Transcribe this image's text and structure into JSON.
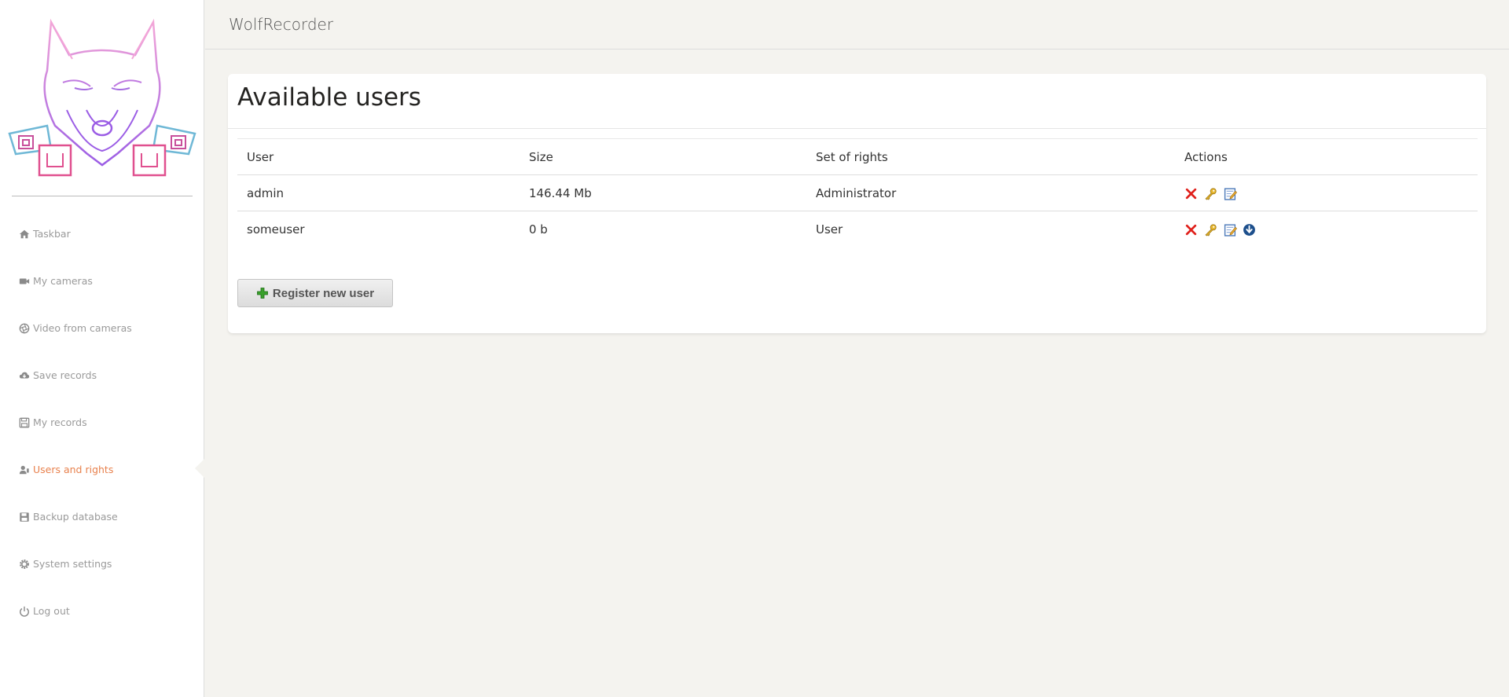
{
  "app": {
    "title": "WolfRecorder"
  },
  "sidebar": {
    "logo_icon": "wolf-camera-logo",
    "items": [
      {
        "label": "Taskbar",
        "icon": "home-icon",
        "active": false
      },
      {
        "label": "My cameras",
        "icon": "video-camera-icon",
        "active": false
      },
      {
        "label": "Video from cameras",
        "icon": "aperture-icon",
        "active": false
      },
      {
        "label": "Save records",
        "icon": "cloud-download-icon",
        "active": false
      },
      {
        "label": "My records",
        "icon": "floppy-disk-icon",
        "active": false
      },
      {
        "label": "Users and rights",
        "icon": "user-key-icon",
        "active": true
      },
      {
        "label": "Backup database",
        "icon": "database-disk-icon",
        "active": false
      },
      {
        "label": "System settings",
        "icon": "gear-icon",
        "active": false
      },
      {
        "label": "Log out",
        "icon": "power-icon",
        "active": false
      }
    ]
  },
  "main": {
    "title": "Available users",
    "table": {
      "headers": [
        "User",
        "Size",
        "Set of rights",
        "Actions"
      ],
      "rows": [
        {
          "user": "admin",
          "size": "146.44 Mb",
          "rights": "Administrator",
          "actions": [
            "delete-icon",
            "key-icon",
            "edit-icon"
          ]
        },
        {
          "user": "someuser",
          "size": "0 b",
          "rights": "User",
          "actions": [
            "delete-icon",
            "key-icon",
            "edit-icon",
            "download-icon"
          ]
        }
      ]
    },
    "register_button": {
      "label": "Register new user",
      "icon": "plus-icon"
    }
  },
  "colors": {
    "accent": "#e8814d",
    "background": "#f4f3ef",
    "nav_text": "#9a9a9a",
    "delete": "#e0201b",
    "plus": "#3aa02c"
  }
}
